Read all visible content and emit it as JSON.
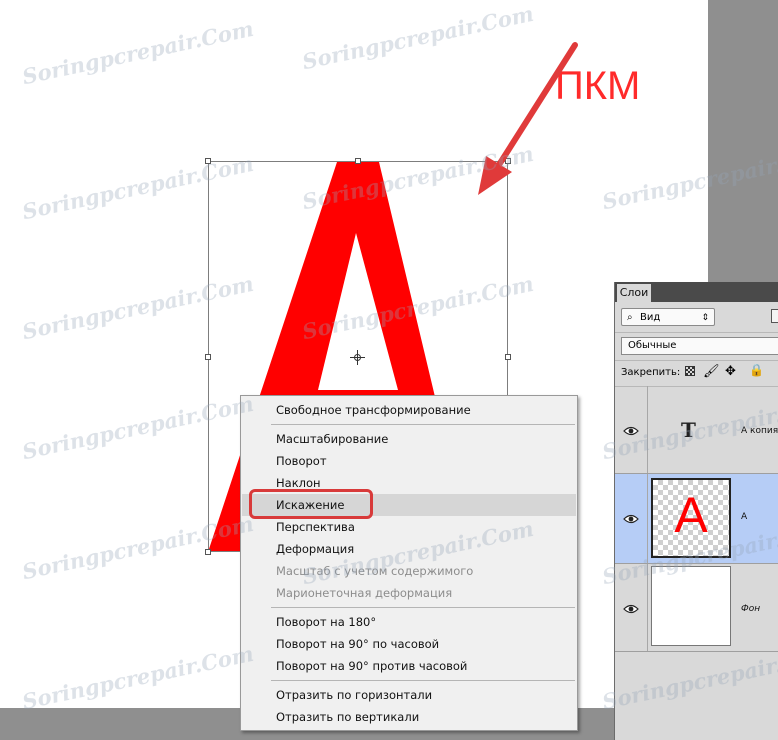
{
  "annotation": {
    "label": "ПКМ",
    "color": "#ff2a2a"
  },
  "watermark": {
    "text": "Soringpcrepair.Com"
  },
  "document": {
    "letter": "A",
    "letter_color": "#ff0000"
  },
  "context_menu": {
    "groups": [
      [
        {
          "label": "Свободное трансформирование",
          "enabled": true
        }
      ],
      [
        {
          "label": "Масштабирование",
          "enabled": true
        },
        {
          "label": "Поворот",
          "enabled": true
        },
        {
          "label": "Наклон",
          "enabled": true
        },
        {
          "label": "Искажение",
          "enabled": true,
          "highlighted": true
        },
        {
          "label": "Перспектива",
          "enabled": true
        },
        {
          "label": "Деформация",
          "enabled": true
        },
        {
          "label": "Масштаб с учетом содержимого",
          "enabled": false
        },
        {
          "label": "Марионеточная деформация",
          "enabled": false
        }
      ],
      [
        {
          "label": "Поворот на 180°",
          "enabled": true
        },
        {
          "label": "Поворот на 90° по часовой",
          "enabled": true
        },
        {
          "label": "Поворот на 90° против часовой",
          "enabled": true
        }
      ],
      [
        {
          "label": "Отразить по горизонтали",
          "enabled": true
        },
        {
          "label": "Отразить по вертикали",
          "enabled": true
        }
      ]
    ],
    "highlight_color": "#d83a3a"
  },
  "layers_panel": {
    "tab_label": "Слои",
    "kind_filter": "Вид",
    "blend_mode": "Обычные",
    "lock_label": "Закрепить:",
    "layers": [
      {
        "name": "А копия",
        "type": "text",
        "thumb_glyph": "T",
        "selected": false
      },
      {
        "name": "А",
        "type": "raster",
        "thumb_glyph": "A",
        "selected": true
      },
      {
        "name": "Фон",
        "type": "background",
        "thumb_glyph": "",
        "selected": false
      }
    ],
    "selected_color": "#b6cdf6"
  }
}
